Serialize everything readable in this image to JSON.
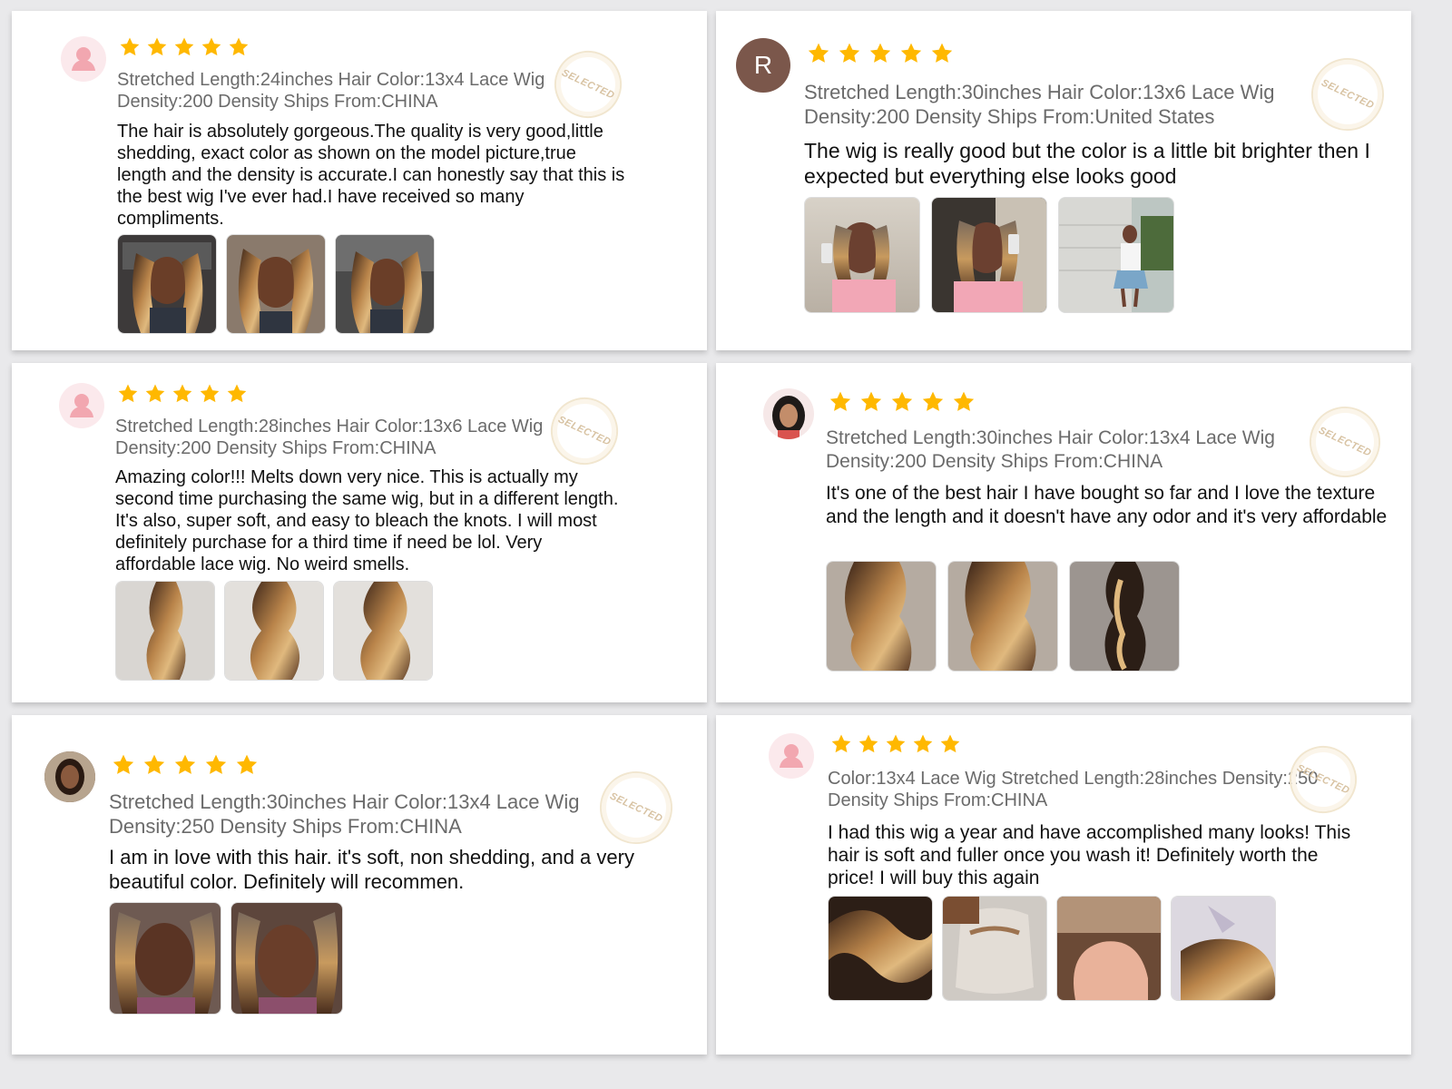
{
  "stamp_label": "SELECTED",
  "colors": {
    "star": "#ffb800",
    "page_bg": "#e9e9eb",
    "card_bg": "#ffffff",
    "variant_text": "#6b6b6b"
  },
  "reviews": [
    {
      "avatar": "person-icon",
      "rating": 5,
      "variant_line1": "Stretched Length:24inches Hair Color:13x4 Lace Wig",
      "variant_line2": "Density:200 Density Ships From:CHINA",
      "text": "The hair is absolutely gorgeous.The quality is very good,little shedding, exact color as shown on the model picture,true length and the density is accurate.I can honestly say that this is the best wig I've ever had.I have received so many compliments.",
      "photos": 3
    },
    {
      "avatar": "letter-avatar",
      "avatar_letter": "R",
      "rating": 5,
      "variant_line1": "Stretched Length:30inches Hair Color:13x6 Lace Wig",
      "variant_line2": "Density:200 Density Ships From:United States",
      "text": "The wig is really good but the color is a little bit brighter then I expected but everything else looks good",
      "photos": 3
    },
    {
      "avatar": "person-icon",
      "rating": 5,
      "variant_line1": "Stretched Length:28inches Hair Color:13x6 Lace Wig",
      "variant_line2": "Density:200 Density Ships From:CHINA",
      "text": "Amazing color!!! Melts down very nice. This is actually my second time purchasing the same wig, but in a different length. It's also, super soft, and easy to bleach the knots. I will most definitely purchase for a third time if need be lol. Very affordable lace wig. No weird smells.",
      "photos": 3
    },
    {
      "avatar": "profile-photo",
      "rating": 5,
      "variant_line1": "Stretched Length:30inches Hair Color:13x4 Lace Wig",
      "variant_line2": "Density:200 Density Ships From:CHINA",
      "text": "It's one of the best hair I have bought so far and I love the texture and the length and it doesn't have any odor and it's very affordable",
      "photos": 3
    },
    {
      "avatar": "profile-photo",
      "rating": 5,
      "variant_line1": "Stretched Length:30inches Hair Color:13x4 Lace Wig",
      "variant_line2": "Density:250 Density Ships From:CHINA",
      "text": "I am in love with this hair. it's soft, non shedding, and a very beautiful color. Definitely will recommen.",
      "photos": 2
    },
    {
      "avatar": "person-icon",
      "rating": 5,
      "variant_line1": "Color:13x4 Lace Wig Stretched Length:28inches Density:250",
      "variant_line2": "Density Ships From:CHINA",
      "text": "I had this wig a year and have accomplished many looks! This hair is soft and fuller once you wash it! Definitely worth the price! I will buy this again",
      "photos": 4
    }
  ]
}
